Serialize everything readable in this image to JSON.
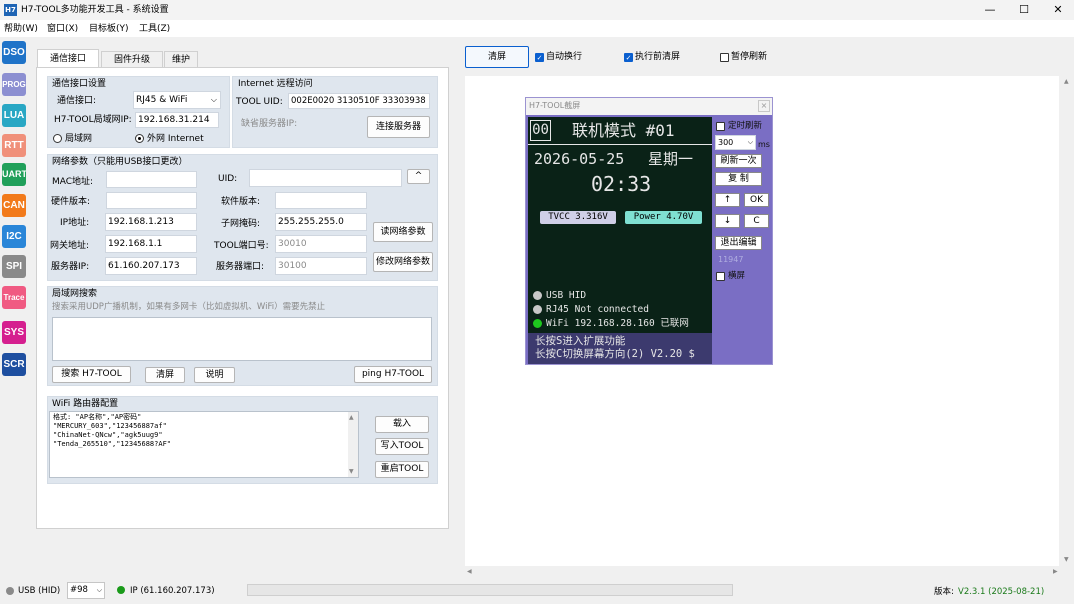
{
  "window": {
    "app_icon": "H7",
    "title": "H7-TOOL多功能开发工具 - 系统设置",
    "minimize": "—",
    "maximize": "☐",
    "close": "✕"
  },
  "menu": [
    "帮助(W)",
    "窗口(X)",
    "目标板(Y)",
    "工具(Z)"
  ],
  "sidebar": [
    {
      "label": "DSO",
      "color": "#1f73c8"
    },
    {
      "label": "PROG",
      "color": "#8c8fd1"
    },
    {
      "label": "LUA",
      "color": "#29a7c4"
    },
    {
      "label": "RTT",
      "color": "#f0907a"
    },
    {
      "label": "UART",
      "color": "#21a05a"
    },
    {
      "label": "CAN",
      "color": "#f27a1a"
    },
    {
      "label": "I2C",
      "color": "#2a86d8"
    },
    {
      "label": "SPI",
      "color": "#8a8a8a"
    },
    {
      "label": "Trace",
      "color": "#f05a82"
    },
    {
      "label": "SYS",
      "color": "#d51f8f"
    },
    {
      "label": "SCR",
      "color": "#1e4fa0"
    }
  ],
  "tabs": [
    "通信接口",
    "固件升级",
    "维护"
  ],
  "comm": {
    "title": "通信接口设置",
    "iface_label": "通信接口:",
    "iface_value": "RJ45 & WiFi",
    "lan_ip_label": "H7-TOOL局域网IP:",
    "lan_ip_value": "192.168.31.214",
    "radio_lan": "局域网",
    "radio_internet": "外网 Internet"
  },
  "internet": {
    "title": "Internet 远程访问",
    "uid_label": "TOOL UID:",
    "uid_value": "002E0020 3130510F 33303938",
    "server_label": "缺省服务器IP:",
    "connect_button": "连接服务器"
  },
  "net": {
    "title": "网络参数（只能用USB接口更改）",
    "mac_label": "MAC地址:",
    "uid_label": "UID:",
    "caret_button": "^",
    "hw_label": "硬件版本:",
    "sw_label": "软件版本:",
    "ip_label": "IP地址:",
    "ip_value": "192.168.1.213",
    "mask_label": "子网掩码:",
    "mask_value": "255.255.255.0",
    "read_button": "读网络参数",
    "gw_label": "网关地址:",
    "gw_value": "192.168.1.1",
    "port_label": "TOOL端口号:",
    "port_value": "30010",
    "modify_button": "修改网络参数",
    "server_label": "服务器IP:",
    "server_value": "61.160.207.173",
    "server_port_label": "服务器端口:",
    "server_port_value": "30100"
  },
  "lan_search": {
    "title": "局域网搜索",
    "hint": "搜索采用UDP广播机制，如果有多网卡（比如虚拟机、WiFi）需要先禁止",
    "search_button": "搜索 H7-TOOL",
    "clear_button": "清屏",
    "help_button": "说明",
    "ping_button": "ping H7-TOOL"
  },
  "wifi": {
    "title": "WiFi 路由器配置",
    "lines": [
      "格式: \"AP名称\",\"AP密码\"",
      "\"MERCURY_603\",\"123456887af\"",
      "\"ChinaNet-QNcw\",\"agk5uug9\"",
      "\"Tenda_265510\",\"12345688?AF\""
    ],
    "load_button": "载入",
    "write_button": "写入TOOL",
    "restart_button": "重启TOOL"
  },
  "toolbar": {
    "clear_button": "清屏",
    "auto_wrap": "自动换行",
    "clear_before_exec": "执行前清屏",
    "pause_refresh": "暂停刷新"
  },
  "screenshot_window": {
    "title": "H7-TOOL截屏",
    "close": "×",
    "header_num": "00",
    "header_title": "联机模式 #01",
    "date": "2026-05-25",
    "weekday": "星期一",
    "time": "02:33",
    "tvcc": "TVCC 3.316V",
    "power": "Power 4.70V",
    "status_lines": [
      {
        "text": "USB HID",
        "color": "#c8c8c8"
      },
      {
        "text": "RJ45 Not connected",
        "color": "#c8c8c8"
      },
      {
        "text": "WiFi 192.168.28.160 已联网",
        "color": "#1ec81e"
      }
    ],
    "footer_line1": "长按S进入扩展功能",
    "footer_line2": "长按C切换屏幕方向(2) V2.20 $",
    "timer_refresh": "定时刷新",
    "interval_value": "300",
    "interval_unit": "ms",
    "refresh_once": "刷新一次",
    "copy_button": "复 制",
    "up_button": "↑",
    "ok_button": "OK",
    "down_button": "↓",
    "c_button": "C",
    "exit_edit": "退出编辑",
    "counter": "11947",
    "landscape": "横屏"
  },
  "status": {
    "usb": "USB (HID)",
    "port": "#98",
    "ip": "IP (61.160.207.173)",
    "version_label": "版本:",
    "version_value": "V2.3.1 (2025-08-21)"
  }
}
